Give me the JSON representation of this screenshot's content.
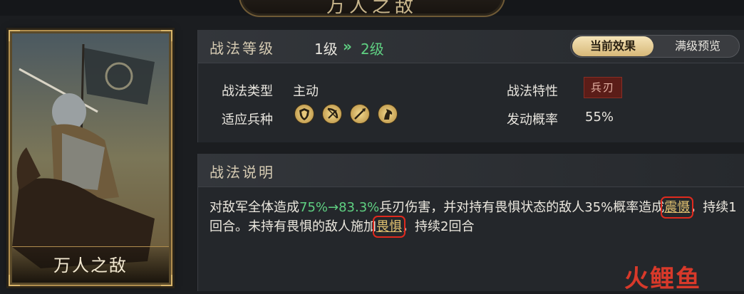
{
  "header": {
    "plaque_title": "万人之敌"
  },
  "card": {
    "name": "万人之敌"
  },
  "level": {
    "title": "战法等级",
    "from": "1级",
    "arrow": "»",
    "to": "2级"
  },
  "toggle": {
    "current": "当前效果",
    "max": "满级预览",
    "active": "current"
  },
  "attributes": {
    "type_label": "战法类型",
    "type_value": "主动",
    "trait_label": "战法特性",
    "trait_value": "兵刃",
    "troop_label": "适应兵种",
    "troops": [
      "shield-icon",
      "bow-icon",
      "spear-icon",
      "horse-icon"
    ],
    "rate_label": "发动概率",
    "rate_value": "55%"
  },
  "description": {
    "title": "战法说明",
    "p1": "对敌军全体造成",
    "dmg": "75%→83.3%",
    "p2": "兵刃伤害，并对持有畏惧状态的敌人35%概率造成",
    "kw1": "震慑",
    "p3": "，持续1回合。未持有畏惧的敌人施加",
    "kw2": "畏惧",
    "p4": "，持续2回合"
  },
  "watermark": "火鲤鱼",
  "colors": {
    "green": "#5fd082",
    "gold": "#d7b878",
    "highlight_box": "#e02a1e"
  }
}
